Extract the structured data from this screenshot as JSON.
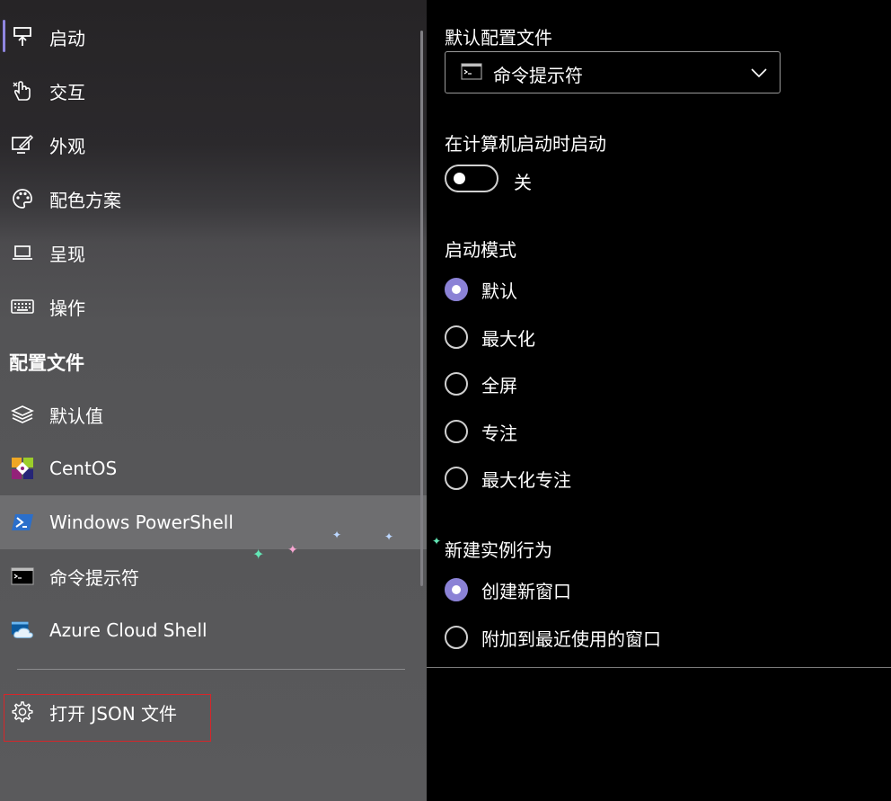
{
  "nav": {
    "items": [
      {
        "label": "启动",
        "icon": "startup-icon"
      },
      {
        "label": "交互",
        "icon": "interaction-icon"
      },
      {
        "label": "外观",
        "icon": "appearance-icon"
      },
      {
        "label": "配色方案",
        "icon": "palette-icon"
      },
      {
        "label": "呈现",
        "icon": "rendering-icon"
      },
      {
        "label": "操作",
        "icon": "keyboard-icon"
      }
    ],
    "profiles_header": "配置文件",
    "profiles": [
      {
        "label": "默认值",
        "icon": "layers-icon"
      },
      {
        "label": "CentOS",
        "icon": "centos-icon"
      },
      {
        "label": "Windows PowerShell",
        "icon": "powershell-icon"
      },
      {
        "label": "命令提示符",
        "icon": "cmd-icon"
      },
      {
        "label": "Azure Cloud Shell",
        "icon": "azure-cloud-shell-icon"
      }
    ],
    "open_json_label": "打开 JSON 文件",
    "selected": "启动",
    "hovered": "Windows PowerShell"
  },
  "settings": {
    "default_profile": {
      "header": "默认配置文件",
      "value": "命令提示符"
    },
    "launch_on_startup": {
      "header": "在计算机启动时启动",
      "state_label": "关",
      "on": false
    },
    "launch_mode": {
      "header": "启动模式",
      "options": [
        "默认",
        "最大化",
        "全屏",
        "专注",
        "最大化专注"
      ],
      "selected": "默认"
    },
    "new_instance_behavior": {
      "header": "新建实例行为",
      "options": [
        "创建新窗口",
        "附加到最近使用的窗口"
      ],
      "selected": "创建新窗口"
    }
  },
  "colors": {
    "accent": "#8b82d6",
    "selection_bar": "#8f86e0",
    "highlight_box": "#d6262a",
    "panel_bg": "#000000"
  }
}
